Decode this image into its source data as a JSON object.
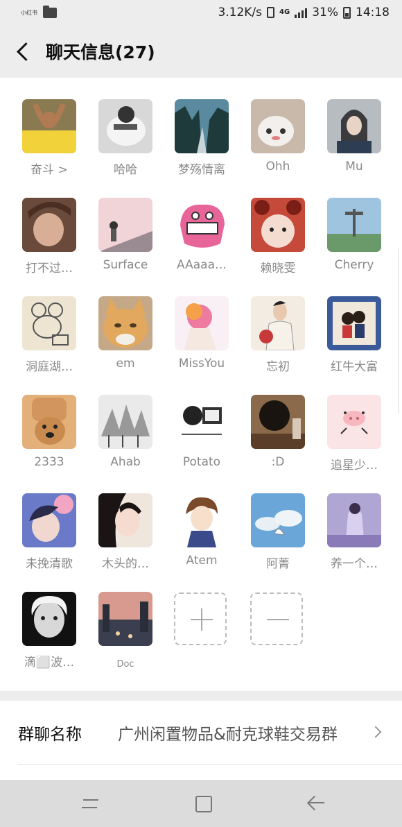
{
  "status_bar": {
    "left_small_text": "小红书",
    "speed": "3.12K/s",
    "network": "4G",
    "battery": "31%",
    "time": "14:18"
  },
  "header": {
    "title": "聊天信息(27)"
  },
  "members": [
    {
      "name": "奋斗 >"
    },
    {
      "name": "哈哈"
    },
    {
      "name": "梦殇情离"
    },
    {
      "name": "Ohh"
    },
    {
      "name": "Mu"
    },
    {
      "name": "打不过…"
    },
    {
      "name": "Surface"
    },
    {
      "name": "AAaaa…"
    },
    {
      "name": "赖晓雯"
    },
    {
      "name": "Cherry"
    },
    {
      "name": "洞庭湖…"
    },
    {
      "name": "em"
    },
    {
      "name": "MissYou"
    },
    {
      "name": "忘初"
    },
    {
      "name": "红牛大富"
    },
    {
      "name": "2333"
    },
    {
      "name": "Ahab"
    },
    {
      "name": "Potato"
    },
    {
      "name": ":D"
    },
    {
      "name": "追星少…"
    },
    {
      "name": "未挽清歌"
    },
    {
      "name": "木头的…"
    },
    {
      "name": "Atem"
    },
    {
      "name": "阿菁"
    },
    {
      "name": "养一个…"
    },
    {
      "name": "滴⬜波…"
    },
    {
      "name": "Doc"
    }
  ],
  "settings": {
    "group_name_label": "群聊名称",
    "group_name_value": "广州闲置物品&耐克球鞋交易群"
  },
  "colors": {
    "page_bg": "#ededed",
    "panel_bg": "#ffffff",
    "name_gray": "#888888",
    "nav_bg": "#dcdcdc"
  }
}
